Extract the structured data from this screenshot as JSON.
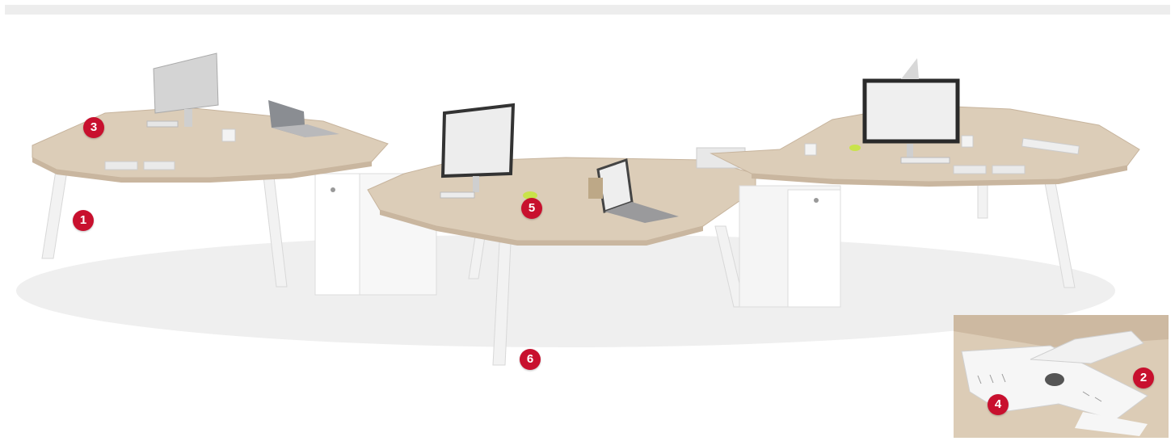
{
  "markers": [
    {
      "label": "1",
      "color": "#c8102e"
    },
    {
      "label": "2",
      "color": "#c8102e"
    },
    {
      "label": "3",
      "color": "#c8102e"
    },
    {
      "label": "4",
      "color": "#c8102e"
    },
    {
      "label": "5",
      "color": "#c8102e"
    },
    {
      "label": "6",
      "color": "#c8102e"
    }
  ],
  "colors": {
    "desktop_wood": "#d9c9b4",
    "desk_edge": "#c7b49d",
    "frame_white": "#f4f4f4",
    "shadow": "#e6e6e6",
    "marker_red": "#c8102e"
  }
}
